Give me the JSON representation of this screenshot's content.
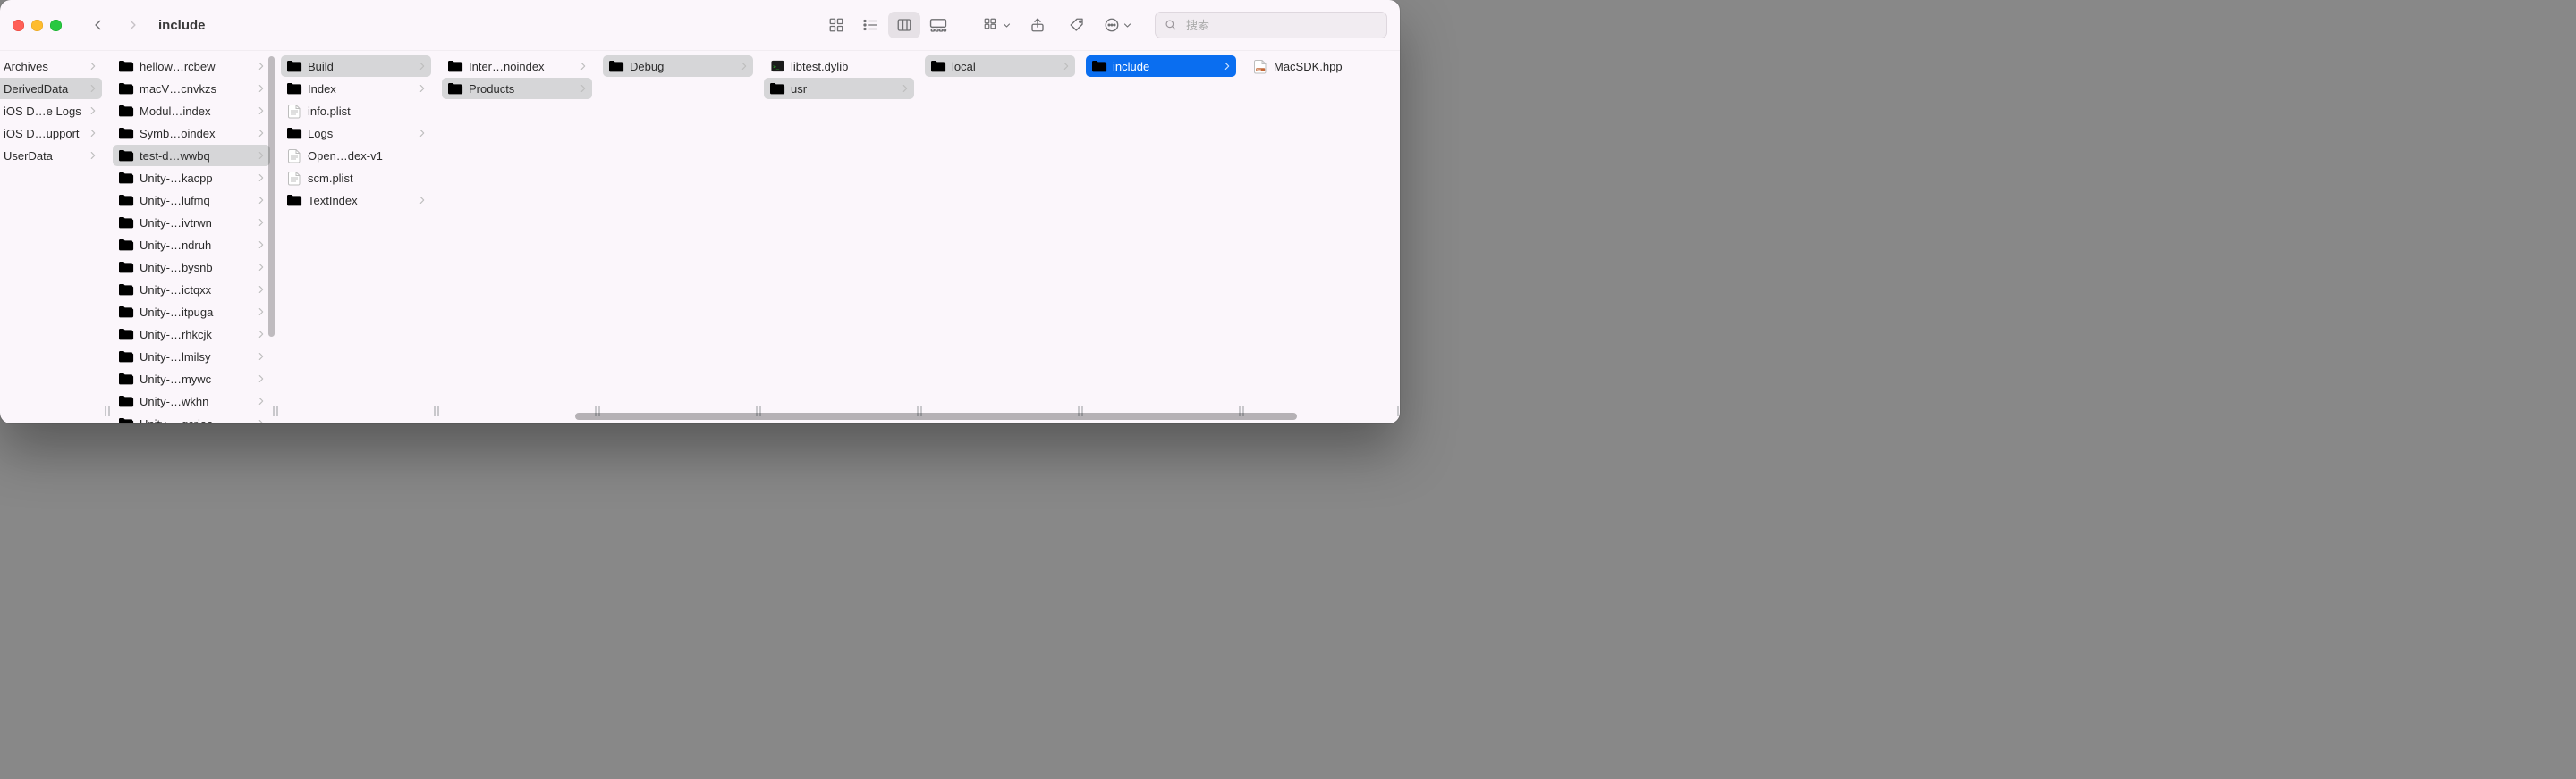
{
  "window": {
    "title": "include"
  },
  "search": {
    "placeholder": "搜索"
  },
  "toolbar": {
    "views": {
      "icon": "icon-view",
      "list": "list-view",
      "column": "column-view",
      "gallery": "gallery-view",
      "active": "column"
    }
  },
  "columns": [
    {
      "width": 120,
      "first": true,
      "items": [
        {
          "label": "Archives",
          "kind": "folder",
          "hasChildren": true,
          "selected": "",
          "showIcon": false
        },
        {
          "label": "DerivedData",
          "kind": "folder",
          "hasChildren": true,
          "selected": "grey",
          "showIcon": false
        },
        {
          "label": "iOS D…e Logs",
          "kind": "folder",
          "hasChildren": true,
          "selected": "",
          "showIcon": false
        },
        {
          "label": "iOS D…upport",
          "kind": "folder",
          "hasChildren": true,
          "selected": "",
          "showIcon": false
        },
        {
          "label": "UserData",
          "kind": "folder",
          "hasChildren": true,
          "selected": "",
          "showIcon": false
        }
      ]
    },
    {
      "width": 188,
      "scrollbar": true,
      "items": [
        {
          "label": "hellow…rcbew",
          "kind": "folder",
          "hasChildren": true,
          "selected": ""
        },
        {
          "label": "macV…cnvkzs",
          "kind": "folder",
          "hasChildren": true,
          "selected": ""
        },
        {
          "label": "Modul…index",
          "kind": "folder",
          "hasChildren": true,
          "selected": ""
        },
        {
          "label": "Symb…oindex",
          "kind": "folder",
          "hasChildren": true,
          "selected": ""
        },
        {
          "label": "test-d…wwbq",
          "kind": "folder",
          "hasChildren": true,
          "selected": "grey"
        },
        {
          "label": "Unity-…kacpp",
          "kind": "folder",
          "hasChildren": true,
          "selected": ""
        },
        {
          "label": "Unity-…lufmq",
          "kind": "folder",
          "hasChildren": true,
          "selected": ""
        },
        {
          "label": "Unity-…ivtrwn",
          "kind": "folder",
          "hasChildren": true,
          "selected": ""
        },
        {
          "label": "Unity-…ndruh",
          "kind": "folder",
          "hasChildren": true,
          "selected": ""
        },
        {
          "label": "Unity-…bysnb",
          "kind": "folder",
          "hasChildren": true,
          "selected": ""
        },
        {
          "label": "Unity-…ictqxx",
          "kind": "folder",
          "hasChildren": true,
          "selected": ""
        },
        {
          "label": "Unity-…itpuga",
          "kind": "folder",
          "hasChildren": true,
          "selected": ""
        },
        {
          "label": "Unity-…rhkcjk",
          "kind": "folder",
          "hasChildren": true,
          "selected": ""
        },
        {
          "label": "Unity-…lmilsy",
          "kind": "folder",
          "hasChildren": true,
          "selected": ""
        },
        {
          "label": "Unity-…mywc",
          "kind": "folder",
          "hasChildren": true,
          "selected": ""
        },
        {
          "label": "Unity-…wkhn",
          "kind": "folder",
          "hasChildren": true,
          "selected": ""
        },
        {
          "label": "Unity-…gcriaa",
          "kind": "folder",
          "hasChildren": true,
          "selected": ""
        }
      ]
    },
    {
      "width": 180,
      "items": [
        {
          "label": "Build",
          "kind": "folder",
          "hasChildren": true,
          "selected": "grey"
        },
        {
          "label": "Index",
          "kind": "folder",
          "hasChildren": true,
          "selected": ""
        },
        {
          "label": "info.plist",
          "kind": "file",
          "hasChildren": false,
          "selected": ""
        },
        {
          "label": "Logs",
          "kind": "folder",
          "hasChildren": true,
          "selected": ""
        },
        {
          "label": "Open…dex-v1",
          "kind": "file",
          "hasChildren": false,
          "selected": ""
        },
        {
          "label": "scm.plist",
          "kind": "file",
          "hasChildren": false,
          "selected": ""
        },
        {
          "label": "TextIndex",
          "kind": "folder",
          "hasChildren": true,
          "selected": ""
        }
      ]
    },
    {
      "width": 180,
      "items": [
        {
          "label": "Inter…noindex",
          "kind": "folder",
          "hasChildren": true,
          "selected": ""
        },
        {
          "label": "Products",
          "kind": "folder",
          "hasChildren": true,
          "selected": "grey"
        }
      ]
    },
    {
      "width": 180,
      "items": [
        {
          "label": "Debug",
          "kind": "folder",
          "hasChildren": true,
          "selected": "grey"
        }
      ]
    },
    {
      "width": 180,
      "items": [
        {
          "label": "libtest.dylib",
          "kind": "exec",
          "hasChildren": false,
          "selected": ""
        },
        {
          "label": "usr",
          "kind": "folder",
          "hasChildren": true,
          "selected": "grey"
        }
      ]
    },
    {
      "width": 180,
      "items": [
        {
          "label": "local",
          "kind": "folder",
          "hasChildren": true,
          "selected": "grey"
        }
      ]
    },
    {
      "width": 180,
      "items": [
        {
          "label": "include",
          "kind": "folder",
          "hasChildren": true,
          "selected": "blue"
        }
      ]
    },
    {
      "width": 177,
      "items": [
        {
          "label": "MacSDK.hpp",
          "kind": "hpp",
          "hasChildren": false,
          "selected": ""
        }
      ]
    }
  ],
  "hscroll": {
    "pos_pct": 41,
    "len_pct": 52
  }
}
